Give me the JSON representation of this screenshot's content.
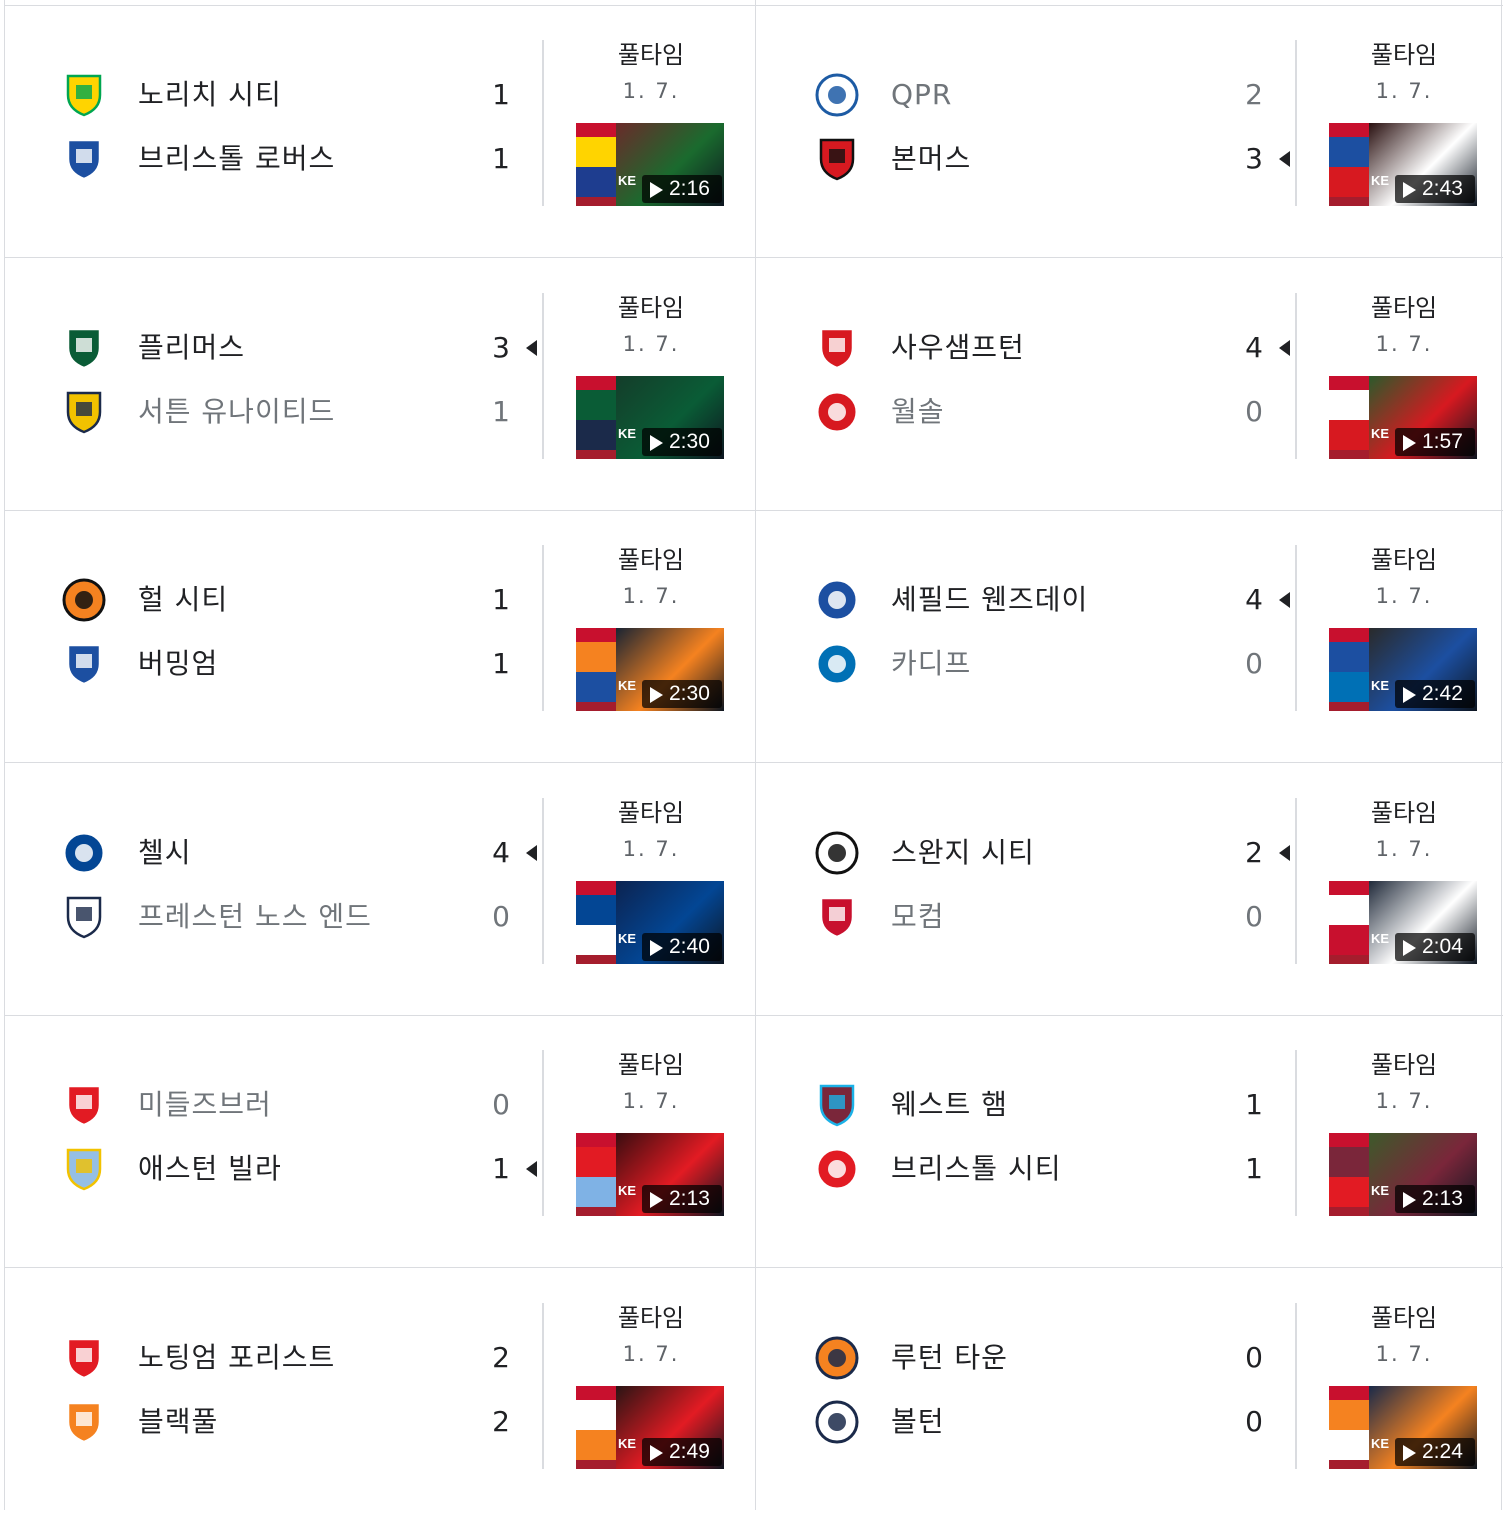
{
  "matches": [
    {
      "status": "풀타임",
      "date": "1. 7.",
      "duration": "2:16",
      "winner": -1,
      "thumb": [
        "#1a6b2e",
        "#ffd400",
        "#1e3d8f",
        "#6a2a2a"
      ],
      "teams": [
        {
          "name": "노리치 시티",
          "score": "1",
          "logo": "norwich-crest-icon",
          "c1": "#ffd400",
          "c2": "#00a650",
          "loser": false
        },
        {
          "name": "브리스톨 로버스",
          "score": "1",
          "logo": "bristol-rovers-crest-icon",
          "c1": "#1c4fa1",
          "c2": "#ffffff",
          "loser": false
        }
      ]
    },
    {
      "status": "풀타임",
      "date": "1. 7.",
      "duration": "2:43",
      "winner": 1,
      "thumb": [
        "#ffffff",
        "#1c4fa1",
        "#d71920",
        "#2a1010"
      ],
      "teams": [
        {
          "name": "QPR",
          "score": "2",
          "logo": "qpr-crest-icon",
          "c1": "#ffffff",
          "c2": "#1d5ba4",
          "loser": true
        },
        {
          "name": "본머스",
          "score": "3",
          "logo": "bournemouth-crest-icon",
          "c1": "#d71920",
          "c2": "#111111",
          "loser": false
        }
      ]
    },
    {
      "status": "풀타임",
      "date": "1. 7.",
      "duration": "2:30",
      "winner": 0,
      "thumb": [
        "#0a5c36",
        "#0a5c36",
        "#1b2a4a",
        "#143d2a"
      ],
      "teams": [
        {
          "name": "플리머스",
          "score": "3",
          "logo": "plymouth-crest-icon",
          "c1": "#0a5c36",
          "c2": "#ffffff",
          "loser": false
        },
        {
          "name": "서튼 유나이티드",
          "score": "1",
          "logo": "sutton-crest-icon",
          "c1": "#f2c200",
          "c2": "#1b2a4a",
          "loser": true
        }
      ]
    },
    {
      "status": "풀타임",
      "date": "1. 7.",
      "duration": "1:57",
      "winner": 0,
      "thumb": [
        "#d71920",
        "#ffffff",
        "#d71920",
        "#2b5a2b"
      ],
      "teams": [
        {
          "name": "사우샘프턴",
          "score": "4",
          "logo": "southampton-crest-icon",
          "c1": "#d71920",
          "c2": "#ffffff",
          "loser": false
        },
        {
          "name": "월솔",
          "score": "0",
          "logo": "walsall-crest-icon",
          "c1": "#d71920",
          "c2": "#ffffff",
          "loser": true
        }
      ]
    },
    {
      "status": "풀타임",
      "date": "1. 7.",
      "duration": "2:30",
      "winner": -1,
      "thumb": [
        "#f58220",
        "#f58220",
        "#1c4fa1",
        "#1a2433"
      ],
      "teams": [
        {
          "name": "헐 시티",
          "score": "1",
          "logo": "hull-city-crest-icon",
          "c1": "#f58220",
          "c2": "#111111",
          "loser": false
        },
        {
          "name": "버밍엄",
          "score": "1",
          "logo": "birmingham-crest-icon",
          "c1": "#1c4fa1",
          "c2": "#ffffff",
          "loser": false
        }
      ]
    },
    {
      "status": "풀타임",
      "date": "1. 7.",
      "duration": "2:42",
      "winner": 0,
      "thumb": [
        "#1c4fa1",
        "#1c4fa1",
        "#0070b5",
        "#2a2a2a"
      ],
      "teams": [
        {
          "name": "셰필드 웬즈데이",
          "score": "4",
          "logo": "sheffield-wednesday-crest-icon",
          "c1": "#1c4fa1",
          "c2": "#ffffff",
          "loser": false
        },
        {
          "name": "카디프",
          "score": "0",
          "logo": "cardiff-crest-icon",
          "c1": "#0070b5",
          "c2": "#ffffff",
          "loser": true
        }
      ]
    },
    {
      "status": "풀타임",
      "date": "1. 7.",
      "duration": "2:40",
      "winner": 0,
      "thumb": [
        "#034694",
        "#034694",
        "#ffffff",
        "#0c2350"
      ],
      "teams": [
        {
          "name": "첼시",
          "score": "4",
          "logo": "chelsea-crest-icon",
          "c1": "#034694",
          "c2": "#ffffff",
          "loser": false
        },
        {
          "name": "프레스턴 노스 엔드",
          "score": "0",
          "logo": "preston-crest-icon",
          "c1": "#ffffff",
          "c2": "#1b2a4a",
          "loser": true
        }
      ]
    },
    {
      "status": "풀타임",
      "date": "1. 7.",
      "duration": "2:04",
      "winner": 0,
      "thumb": [
        "#ffffff",
        "#ffffff",
        "#c8102e",
        "#202a3a"
      ],
      "teams": [
        {
          "name": "스완지 시티",
          "score": "2",
          "logo": "swansea-crest-icon",
          "c1": "#ffffff",
          "c2": "#111111",
          "loser": false
        },
        {
          "name": "모컴",
          "score": "0",
          "logo": "morecambe-crest-icon",
          "c1": "#c8102e",
          "c2": "#ffffff",
          "loser": true
        }
      ]
    },
    {
      "status": "풀타임",
      "date": "1. 7.",
      "duration": "2:13",
      "winner": 1,
      "thumb": [
        "#e21b23",
        "#e21b23",
        "#7fb2e5",
        "#3a0d10"
      ],
      "teams": [
        {
          "name": "미들즈브러",
          "score": "0",
          "logo": "middlesbrough-crest-icon",
          "c1": "#e21b23",
          "c2": "#ffffff",
          "loser": true
        },
        {
          "name": "애스턴 빌라",
          "score": "1",
          "logo": "aston-villa-crest-icon",
          "c1": "#95bfe5",
          "c2": "#f2c200",
          "loser": false
        }
      ]
    },
    {
      "status": "풀타임",
      "date": "1. 7.",
      "duration": "2:13",
      "winner": -1,
      "thumb": [
        "#7a263a",
        "#7a263a",
        "#e21b23",
        "#3c5a2a"
      ],
      "teams": [
        {
          "name": "웨스트 햄",
          "score": "1",
          "logo": "west-ham-crest-icon",
          "c1": "#7a263a",
          "c2": "#1bb1e7",
          "loser": false
        },
        {
          "name": "브리스톨 시티",
          "score": "1",
          "logo": "bristol-city-crest-icon",
          "c1": "#e21b23",
          "c2": "#ffffff",
          "loser": false
        }
      ]
    },
    {
      "status": "풀타임",
      "date": "1. 7.",
      "duration": "2:49",
      "winner": -1,
      "thumb": [
        "#e21b23",
        "#ffffff",
        "#f58220",
        "#2a1414"
      ],
      "teams": [
        {
          "name": "노팅엄 포리스트",
          "score": "2",
          "logo": "nottingham-forest-crest-icon",
          "c1": "#e21b23",
          "c2": "#ffffff",
          "loser": false
        },
        {
          "name": "블랙풀",
          "score": "2",
          "logo": "blackpool-crest-icon",
          "c1": "#f58220",
          "c2": "#ffffff",
          "loser": false
        }
      ]
    },
    {
      "status": "풀타임",
      "date": "1. 7.",
      "duration": "2:24",
      "winner": -1,
      "thumb": [
        "#f58220",
        "#f58220",
        "#ffffff",
        "#1a2a4a"
      ],
      "teams": [
        {
          "name": "루턴 타운",
          "score": "0",
          "logo": "luton-town-crest-icon",
          "c1": "#f58220",
          "c2": "#1b2a4a",
          "loser": false
        },
        {
          "name": "볼턴",
          "score": "0",
          "logo": "bolton-crest-icon",
          "c1": "#ffffff",
          "c2": "#1b2a4a",
          "loser": false
        }
      ]
    }
  ]
}
